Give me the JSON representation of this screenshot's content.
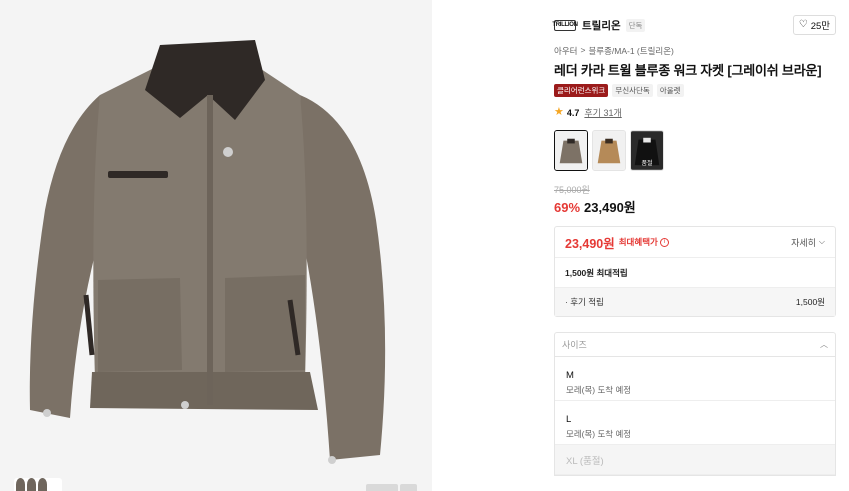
{
  "brand": {
    "logo_text": "TRILLION",
    "name": "트릴리온",
    "tag": "단독"
  },
  "like": {
    "count": "25만"
  },
  "breadcrumb": {
    "cat1": "아우터",
    "sep": ">",
    "cat2": "블루종/MA-1 (트릴리온)"
  },
  "product": {
    "title": "레더 카라 트윌 블루종 워크 자켓 [그레이쉬 브라운]",
    "badges": [
      "클리어런스위크",
      "무신사단독",
      "아울렛"
    ],
    "rating": "4.7",
    "reviews": "후기 31개",
    "original_price": "75,000원",
    "discount": "69%",
    "sale_price": "23,490원"
  },
  "colors": {
    "swatches": [
      {
        "name": "그레이쉬 브라운",
        "color": "#7d7266"
      },
      {
        "name": "베이지",
        "color": "#b58a58"
      },
      {
        "name": "블랙",
        "color": "#1d1d1d",
        "overlay": "품절"
      }
    ]
  },
  "benefit": {
    "price": "23,490원",
    "label": "최대혜택가",
    "detail_label": "자세히",
    "points": "1,500원 최대적립",
    "review_points_label": "· 후기 적립",
    "review_points_value": "1,500원"
  },
  "size": {
    "placeholder": "사이즈",
    "options": [
      {
        "name": "M",
        "note": "모레(목) 도착 예정"
      },
      {
        "name": "L",
        "note": "모레(목) 도착 예정"
      },
      {
        "name": "XL (품절)"
      }
    ]
  }
}
